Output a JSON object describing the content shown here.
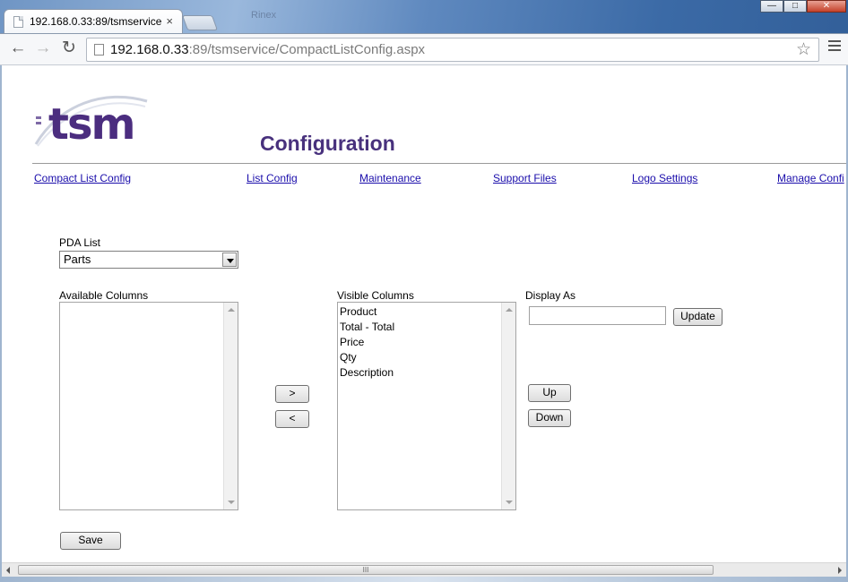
{
  "browser": {
    "tab_title": "192.168.0.33:89/tsmservice",
    "tab_close": "×",
    "ghost_tab": "Rinex",
    "url_host": "192.168.0.33",
    "url_rest": ":89/tsmservice/CompactListConfig.aspx",
    "back": "←",
    "forward": "→",
    "reload": "↻",
    "star": "☆",
    "minimize": "—",
    "maximize": "□",
    "close": "✕"
  },
  "header": {
    "logo_text": "tsm",
    "page_title": "Configuration"
  },
  "nav": {
    "compact_list_config": "Compact List Config",
    "list_config": "List Config",
    "maintenance": "Maintenance",
    "support_files": "Support Files",
    "logo_settings": "Logo Settings",
    "manage_config": "Manage Confi"
  },
  "form": {
    "pda_list_label": "PDA List",
    "pda_list_value": "Parts",
    "available_label": "Available Columns",
    "available_items": [],
    "visible_label": "Visible Columns",
    "visible_items": [
      "Product",
      "Total - Total",
      "Price",
      "Qty",
      "Description"
    ],
    "display_as_label": "Display As",
    "display_as_value": "",
    "update_btn": "Update",
    "move_right_btn": ">",
    "move_left_btn": "<",
    "up_btn": "Up",
    "down_btn": "Down",
    "save_btn": "Save"
  },
  "scrollbar": {
    "grip": "III"
  }
}
